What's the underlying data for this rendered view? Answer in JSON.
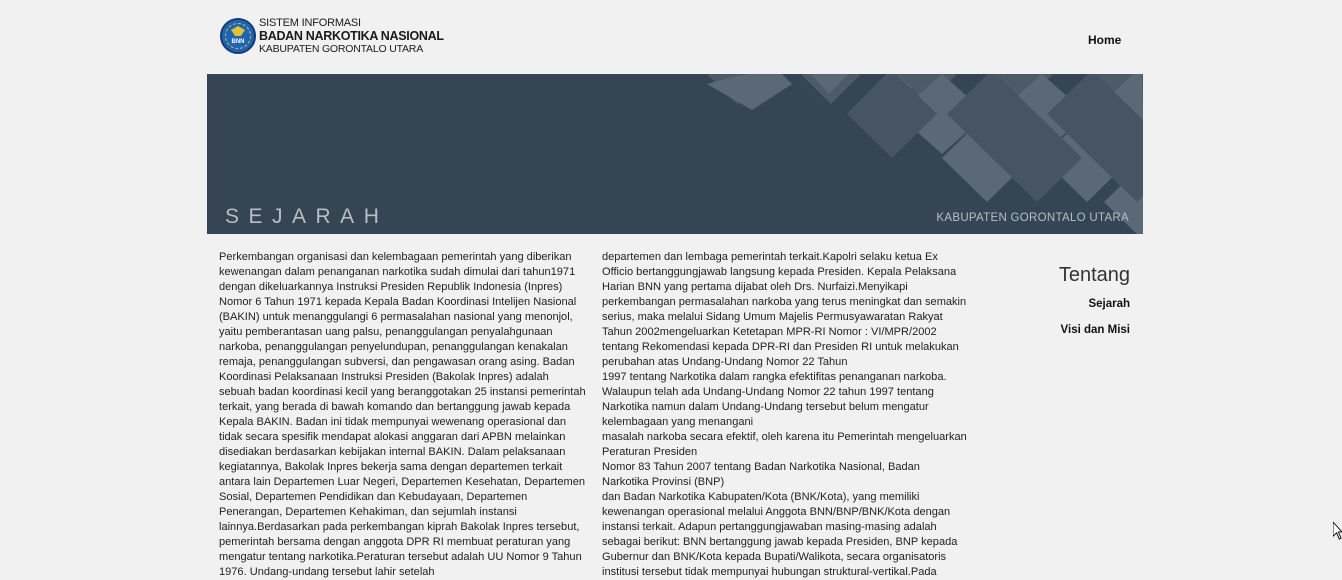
{
  "header": {
    "logo": {
      "line1": "SISTEM INFORMASI",
      "line2": "BADAN NARKOTIKA NASIONAL",
      "line3": "KABUPATEN GORONTALO UTARA",
      "emblem_text": "BNN"
    },
    "nav": {
      "home": "Home"
    }
  },
  "banner": {
    "title": "SEJARAH",
    "subtitle": "KABUPATEN GORONTALO UTARA",
    "colors": {
      "background": "#364554",
      "diamond_light": "#5b6977",
      "diamond_dark": "#475564"
    }
  },
  "content": {
    "col1": [
      "Perkembangan organisasi dan kelembagaan pemerintah yang diberikan",
      "kewenangan dalam penanganan narkotika sudah dimulai dari tahun1971",
      "dengan dikeluarkannya Instruksi Presiden Republik Indonesia (Inpres)",
      "Nomor 6 Tahun 1971 kepada Kepala Badan Koordinasi Intelijen Nasional",
      "(BAKIN) untuk menanggulangi 6 permasalahan nasional yang menonjol,",
      "yaitu pemberantasan uang palsu, penanggulangan penyalahgunaan",
      "narkoba, penanggulangan penyelundupan, penanggulangan kenakalan",
      "remaja, penanggulangan subversi, dan pengawasan orang asing. Badan",
      "Koordinasi Pelaksanaan Instruksi Presiden (Bakolak Inpres) adalah",
      "sebuah badan koordinasi kecil yang beranggotakan 25 instansi pemerintah",
      "terkait, yang berada di bawah komando dan bertanggung jawab kepada",
      "Kepala BAKIN. Badan ini tidak mempunyai wewenang operasional dan",
      "tidak secara spesifik mendapat alokasi anggaran dari APBN melainkan",
      "disediakan berdasarkan kebijakan internal BAKIN. Dalam pelaksanaan",
      "kegiatannya, Bakolak Inpres bekerja sama dengan departemen terkait",
      "antara lain Departemen Luar Negeri, Departemen Kesehatan, Departemen",
      "Sosial, Departemen Pendidikan dan Kebudayaan, Departemen",
      "Penerangan, Departemen Kehakiman, dan sejumlah instansi",
      "lainnya.Berdasarkan pada perkembangan kiprah Bakolak Inpres tersebut,",
      "pemerintah bersama dengan anggota DPR RI membuat peraturan yang",
      "mengatur tentang narkotika.Peraturan tersebut adalah UU Nomor 9 Tahun",
      "1976. Undang-undang tersebut lahir setelah"
    ],
    "col2": [
      "departemen dan lembaga pemerintah terkait.Kapolri selaku ketua Ex",
      "Officio bertanggungjawab langsung kepada Presiden. Kepala Pelaksana",
      "Harian BNN yang pertama dijabat oleh Drs. Nurfaizi.Menyikapi",
      "perkembangan permasalahan narkoba yang terus meningkat dan semakin",
      "serius, maka melalui Sidang Umum Majelis Permusyawaratan Rakyat",
      "Tahun 2002mengeluarkan Ketetapan MPR-RI Nomor : VI/MPR/2002",
      "tentang Rekomendasi kepada DPR-RI dan Presiden RI untuk melakukan",
      "perubahan atas Undang-Undang Nomor 22 Tahun",
      "1997 tentang Narkotika dalam rangka efektifitas penanganan narkoba.",
      "Walaupun telah ada Undang-Undang Nomor 22 tahun 1997 tentang",
      "Narkotika namun dalam Undang-Undang tersebut belum mengatur",
      "kelembagaan yang menangani",
      "masalah narkoba secara efektif, oleh karena itu Pemerintah mengeluarkan",
      "Peraturan Presiden",
      "Nomor 83 Tahun 2007 tentang Badan Narkotika Nasional, Badan",
      "Narkotika Provinsi (BNP)",
      "dan Badan Narkotika Kabupaten/Kota (BNK/Kota), yang memiliki",
      "kewenangan operasional melalui Anggota BNN/BNP/BNK/Kota dengan",
      "instansi terkait. Adapun pertanggungjawaban masing-masing adalah",
      "sebagai berikut: BNN bertanggung jawab kepada Presiden, BNP kepada",
      "Gubernur dan BNK/Kota kepada Bupati/Walikota, secara organisatoris",
      "institusi tersebut tidak mempunyai hubungan struktural-vertikal.Pada"
    ]
  },
  "sidebar": {
    "title": "Tentang",
    "links": [
      "Sejarah",
      "Visi dan Misi"
    ]
  }
}
